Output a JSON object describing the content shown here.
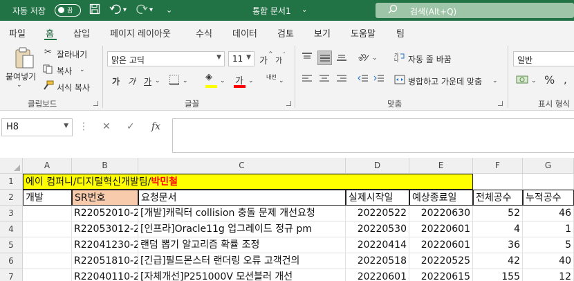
{
  "titlebar": {
    "autosave_label": "자동 저장",
    "toggle_label": "끔",
    "document_title": "통합 문서1",
    "search_placeholder": "검색(Alt+Q)"
  },
  "menu": {
    "tabs": [
      "파일",
      "홈",
      "삽입",
      "페이지 레이아웃",
      "수식",
      "데이터",
      "검토",
      "보기",
      "도움말",
      "팀"
    ],
    "active": "홈"
  },
  "ribbon": {
    "clipboard": {
      "paste": "붙여넣기",
      "cut": "잘라내기",
      "copy": "복사",
      "format_painter": "서식 복사",
      "label": "클립보드"
    },
    "font": {
      "name": "맑은 고딕",
      "size": "11",
      "grow": "가",
      "shrink": "가",
      "bold": "가",
      "italic": "가",
      "underline": "가",
      "font_color_glyph": "가",
      "phonetic": "내천",
      "label": "글꼴",
      "highlight_color": "#ffff00",
      "font_color": "#ff0000"
    },
    "alignment": {
      "wrap_text": "자동 줄 바꿈",
      "merge_center": "병합하고 가운데 맞춤",
      "label": "맞춤"
    },
    "number": {
      "format": "일반",
      "percent": "%",
      "label": "표시 형식"
    }
  },
  "formula_bar": {
    "name_box": "H8",
    "cancel": "✕",
    "enter": "✓",
    "fx": "fx",
    "formula": ""
  },
  "sheet": {
    "columns": [
      "A",
      "B",
      "C",
      "D",
      "E",
      "F",
      "G"
    ],
    "rows": [
      "1",
      "2",
      "3",
      "4",
      "5",
      "6",
      "7"
    ],
    "row1": {
      "text_black": "에이 컴퍼니/디지털혁신개발팀/",
      "text_red": "박민철",
      "fill": "#ffff00",
      "red": "#ff0000"
    },
    "headers": [
      "개발",
      "SR번호",
      "요청문서",
      "실제시작일",
      "예상종료일",
      "전체공수",
      "누적공수"
    ],
    "header_sr_fill": "#f8cbad",
    "data": [
      [
        "",
        "R22052010-2",
        "[개발]캐릭터 collision 충돌 문제 개선요청",
        "20220522",
        "20220630",
        "52",
        "46"
      ],
      [
        "",
        "R22053012-2",
        "[인프라]Oracle11g 업그레이드 정규 pm",
        "20220530",
        "20220601",
        "4",
        "1"
      ],
      [
        "",
        "R22041230-2",
        "랜덤 뽑기 알고리즘 확률 조정",
        "20220414",
        "20220601",
        "36",
        "5"
      ],
      [
        "",
        "R22051810-2",
        "[긴급]필드몬스터 랜더링 오류 고객건의",
        "20220518",
        "20220525",
        "42",
        "40"
      ],
      [
        "",
        "R22040110-2",
        "[자체개선]P251000V 모션블러 개선",
        "20220601",
        "20220615",
        "155",
        "12"
      ]
    ]
  }
}
